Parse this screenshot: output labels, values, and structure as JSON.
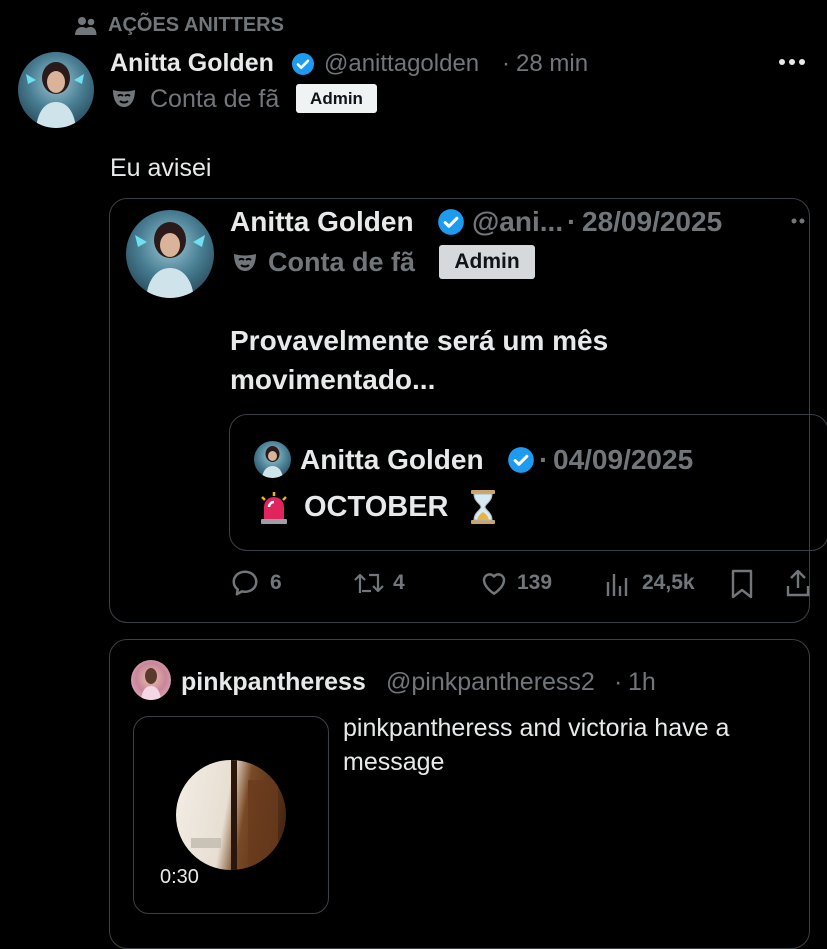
{
  "social_context": {
    "label": "AÇÕES ANITTERS",
    "icon": "people-icon"
  },
  "post": {
    "author_name": "Anitta Golden",
    "handle": "@anittagolden",
    "separator": "·",
    "time": "28 min",
    "label_icon": "mask-icon",
    "label_text": "Conta de fã",
    "badge": "Admin",
    "more_icon": "more-icon",
    "text": "Eu avisei"
  },
  "quote": {
    "author_name": "Anitta Golden",
    "handle": "@ani...",
    "separator": "·",
    "date": "28/09/2025",
    "label_text": "Conta de fã",
    "badge": "Admin",
    "text_line1": "Provavelmente será um mês",
    "text_line2": "movimentado...",
    "nested": {
      "author_name": "Anitta Golden",
      "separator": "·",
      "date": "04/09/2025",
      "text": "OCTOBER",
      "emoji_left": "🚨",
      "emoji_right": "⏳"
    },
    "actions": {
      "replies": "6",
      "reposts": "4",
      "likes": "139",
      "views": "24,5k"
    }
  },
  "embed": {
    "author_name": "pinkpantheress",
    "handle": "@pinkpantheress2",
    "separator": "·",
    "time": "1h",
    "text_line1": "pinkpantheress and victoria have a",
    "text_line2": "message",
    "video_duration": "0:30"
  },
  "colors": {
    "background": "#000000",
    "text": "#e7e9ea",
    "muted": "#71767b",
    "verified": "#1d9bf0",
    "border": "#3b4046"
  }
}
